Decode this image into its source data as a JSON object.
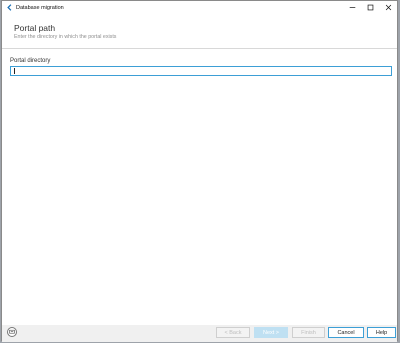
{
  "window": {
    "title": "Database migration"
  },
  "header": {
    "title": "Portal path",
    "subtitle": "Enter the directory in which the portal exists"
  },
  "form": {
    "label": "Portal directory",
    "value": ""
  },
  "footer": {
    "back_label": "< Back",
    "next_label": "Next >",
    "finish_label": "Finish",
    "cancel_label": "Cancel",
    "help_label": "Help"
  },
  "colors": {
    "accent": "#3d9fd6",
    "next_disabled_bg": "#bfe0f2"
  }
}
